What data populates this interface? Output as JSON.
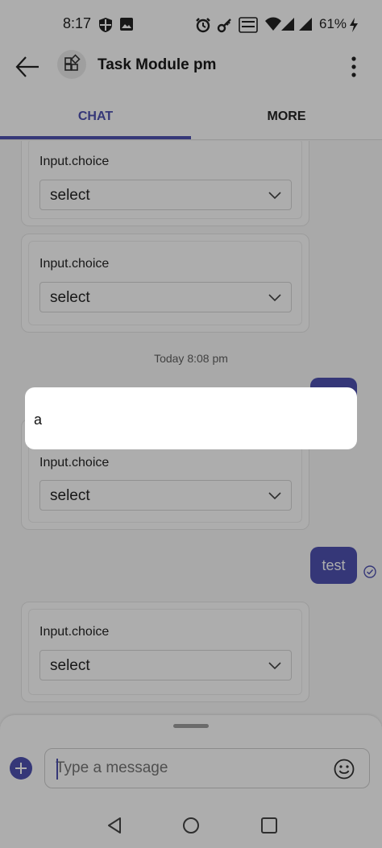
{
  "status_bar": {
    "time": "8:17",
    "battery": "61%"
  },
  "header": {
    "title": "Task Module pm"
  },
  "tabs": [
    {
      "label": "CHAT",
      "active": true
    },
    {
      "label": "MORE",
      "active": false
    }
  ],
  "chat": {
    "cards": [
      {
        "label": "Input.choice",
        "select_value": "select"
      },
      {
        "label": "Input.choice",
        "select_value": "select"
      },
      {
        "label": "Input.choice",
        "select_value": "select"
      },
      {
        "label": "Input.choice",
        "select_value": "select"
      }
    ],
    "timestamp": "Today 8:08 pm",
    "sent_message": "test"
  },
  "composer": {
    "placeholder": "Type a message"
  },
  "popup": {
    "text": "a"
  },
  "colors": {
    "accent": "#4f52b2"
  },
  "icons": [
    "back-arrow-icon",
    "app-icon",
    "more-options-icon",
    "chevron-down-icon",
    "check-circle-icon",
    "add-icon",
    "emoji-icon",
    "nav-back-icon",
    "nav-home-icon",
    "nav-recents-icon"
  ]
}
